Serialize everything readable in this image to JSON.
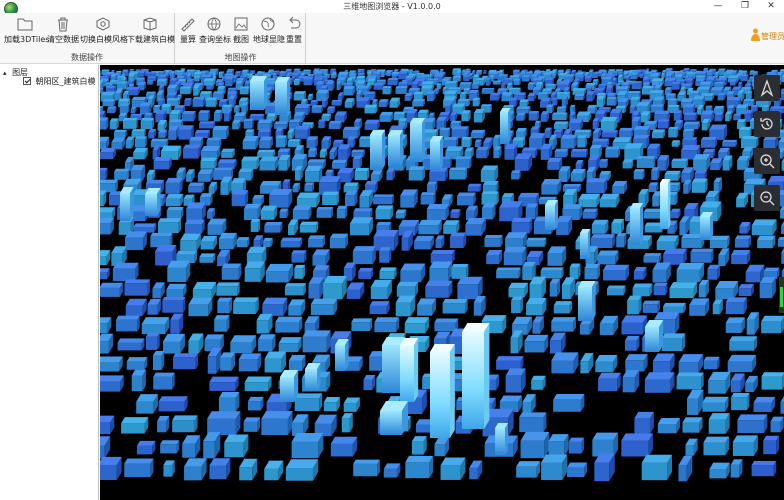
{
  "window": {
    "title": "三维地图浏览器 - V1.0.0.0",
    "controls": {
      "minimize": "—",
      "restore": "❐",
      "close": "✕"
    }
  },
  "ribbon": {
    "groups": [
      {
        "label": "数据操作",
        "tools": [
          {
            "label": "加载3DTiles",
            "icon": "folder-icon"
          },
          {
            "label": "清空数据",
            "icon": "trash-icon"
          },
          {
            "label": "切换白模风格",
            "icon": "style-gear-icon"
          },
          {
            "label": "下载建筑白模",
            "icon": "cube-download-icon"
          }
        ]
      },
      {
        "label": "地图操作",
        "tools": [
          {
            "label": "量算",
            "icon": "ruler-icon"
          },
          {
            "label": "查询坐标",
            "icon": "globe-query-icon"
          },
          {
            "label": "截图",
            "icon": "picture-icon"
          },
          {
            "label": "地球显隐",
            "icon": "globe-icon"
          },
          {
            "label": "重置",
            "icon": "undo-icon"
          }
        ]
      }
    ]
  },
  "user": {
    "label": "管理员",
    "icon": "user-icon"
  },
  "layer_tree": {
    "root": {
      "label": "图层",
      "expander": "▴"
    },
    "children": [
      {
        "label": "朝阳区_建筑白模",
        "checked": true
      }
    ]
  },
  "map_controls": [
    {
      "name": "compass-icon"
    },
    {
      "name": "history-icon"
    },
    {
      "name": "zoom-in-icon"
    },
    {
      "name": "zoom-out-icon"
    }
  ],
  "colors": {
    "building": "#3a8ee6",
    "building_bright": "#8fe6ff",
    "background": "#000000",
    "user_accent": "#d98200"
  }
}
